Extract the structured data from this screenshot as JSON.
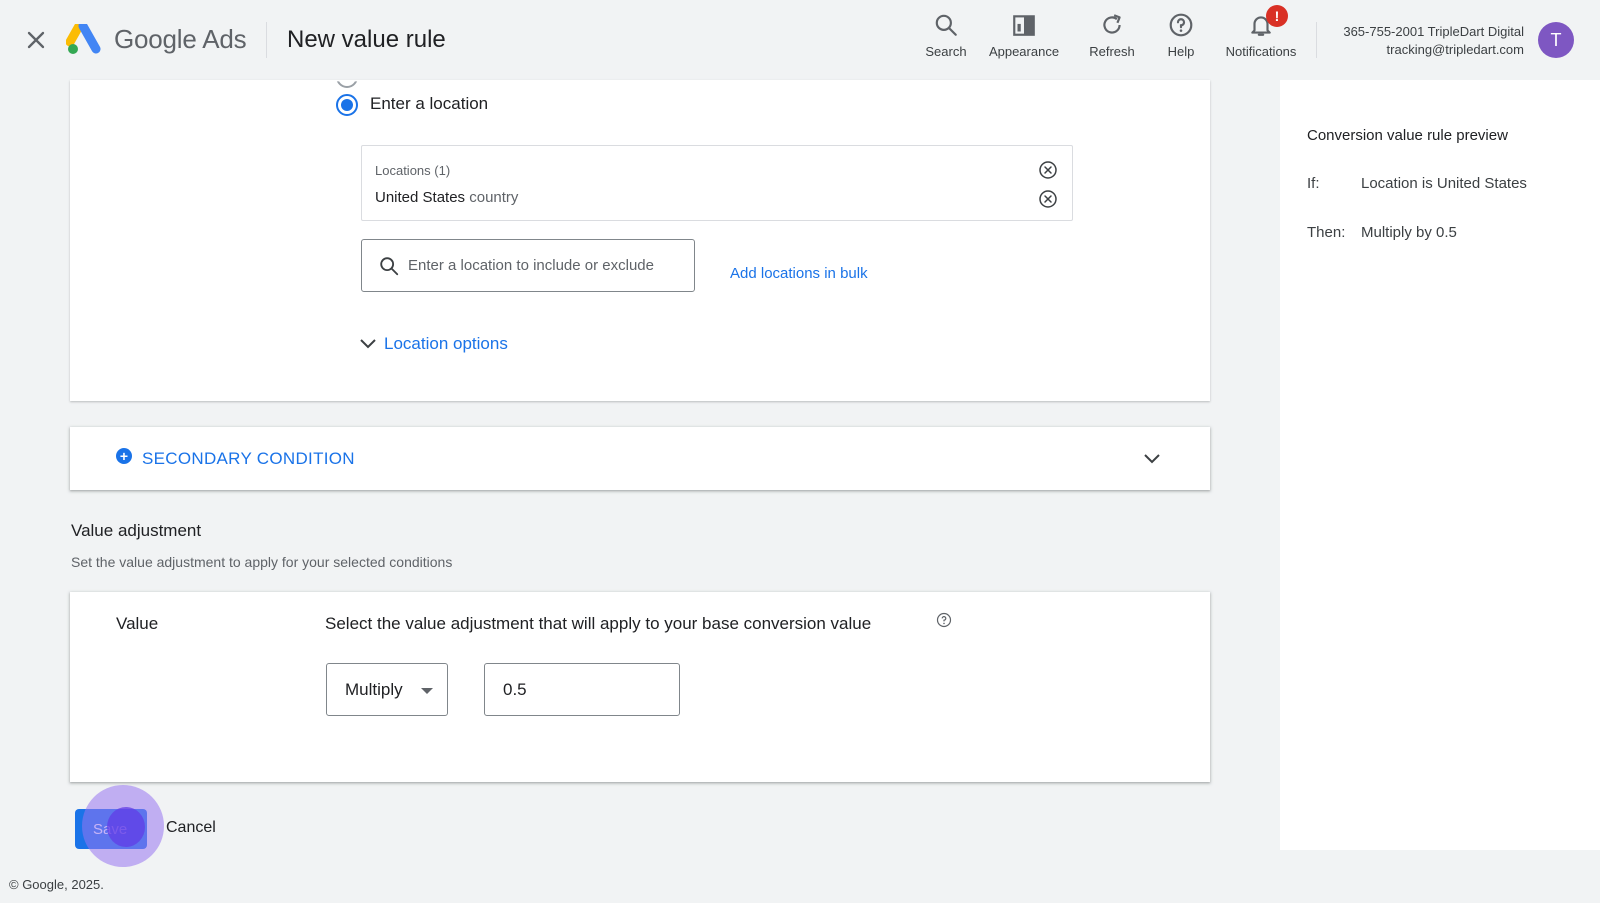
{
  "header": {
    "product_name": "Google Ads",
    "page_title": "New value rule",
    "tools": [
      {
        "label": "Search",
        "icon": "search-icon"
      },
      {
        "label": "Appearance",
        "icon": "appearance-icon"
      },
      {
        "label": "Refresh",
        "icon": "refresh-icon"
      },
      {
        "label": "Help",
        "icon": "help-icon"
      },
      {
        "label": "Notifications",
        "icon": "bell-icon",
        "badge": "!"
      }
    ],
    "account_line1": "365-755-2001 TripleDart Digital",
    "account_line2": "tracking@tripledart.com",
    "avatar_initial": "T"
  },
  "location": {
    "radio_label": "Enter a location",
    "locations_header": "Locations (1)",
    "items": [
      {
        "name": "United States",
        "type": "country"
      }
    ],
    "search_placeholder": "Enter a location to include or exclude",
    "bulk_link": "Add locations in bulk",
    "options_label": "Location options"
  },
  "secondary_condition": {
    "label": "SECONDARY CONDITION"
  },
  "value_adjustment": {
    "title": "Value adjustment",
    "subtitle": "Set the value adjustment to apply for your selected conditions",
    "value_label": "Value",
    "description": "Select the value adjustment that will apply to your base conversion value",
    "operation": "Multiply",
    "amount": "0.5"
  },
  "actions": {
    "save_label": "Save",
    "cancel_label": "Cancel"
  },
  "footer": {
    "copyright": "© Google, 2025."
  },
  "preview": {
    "title": "Conversion value rule preview",
    "if_key": "If:",
    "if_value": "Location is United States",
    "then_key": "Then:",
    "then_value": "Multiply by 0.5"
  },
  "colors": {
    "accent": "#1a73e8",
    "badge": "#d93025",
    "avatar": "#7e57c2",
    "background": "#f1f3f4"
  }
}
